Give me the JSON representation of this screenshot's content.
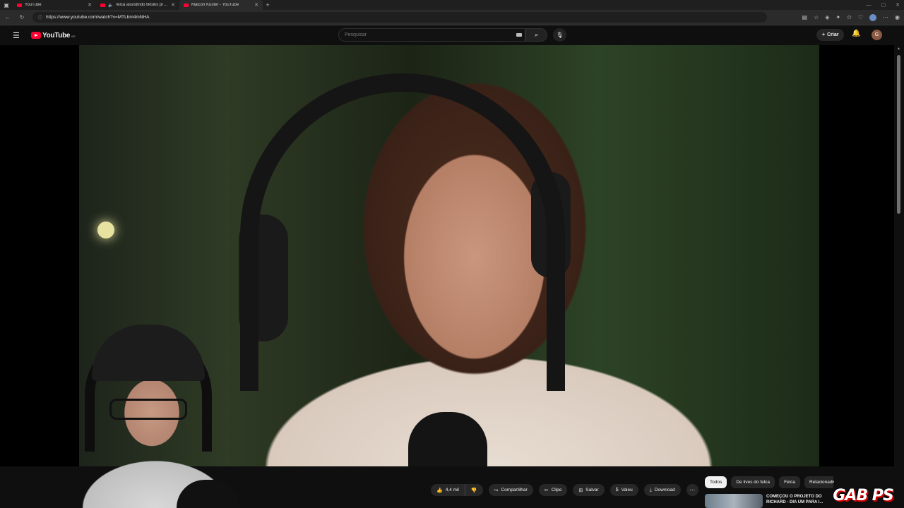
{
  "browser": {
    "tabs": [
      {
        "title": "YouTube",
        "active": false
      },
      {
        "title": "felca assistindo tiktoks pra...",
        "active": false,
        "audio": true
      },
      {
        "title": "Maicon Küster - YouTube",
        "active": true
      }
    ],
    "url": "https://www.youtube.com/watch?v=MTLbm4mNHA"
  },
  "masthead": {
    "logo_text": "YouTube",
    "country_code": "BR",
    "search_placeholder": "Pesquisar",
    "create_label": "Criar",
    "avatar_letter": "G"
  },
  "actions": {
    "like_count": "4,4 mil",
    "share_label": "Compartilhar",
    "clip_label": "Clipe",
    "save_label": "Salvar",
    "thanks_label": "Valeu",
    "download_label": "Download"
  },
  "chips": [
    "Todos",
    "De lives do felca",
    "Felca",
    "Relacionados"
  ],
  "recommended": {
    "title": "COMEÇOU O PROJETO DO RICHARD - DIA UM PARA I..."
  },
  "watermark": {
    "text": "GAB PS"
  },
  "colors": {
    "accent": "#ff0033",
    "background": "#0f0f0f",
    "pill": "#272727"
  }
}
